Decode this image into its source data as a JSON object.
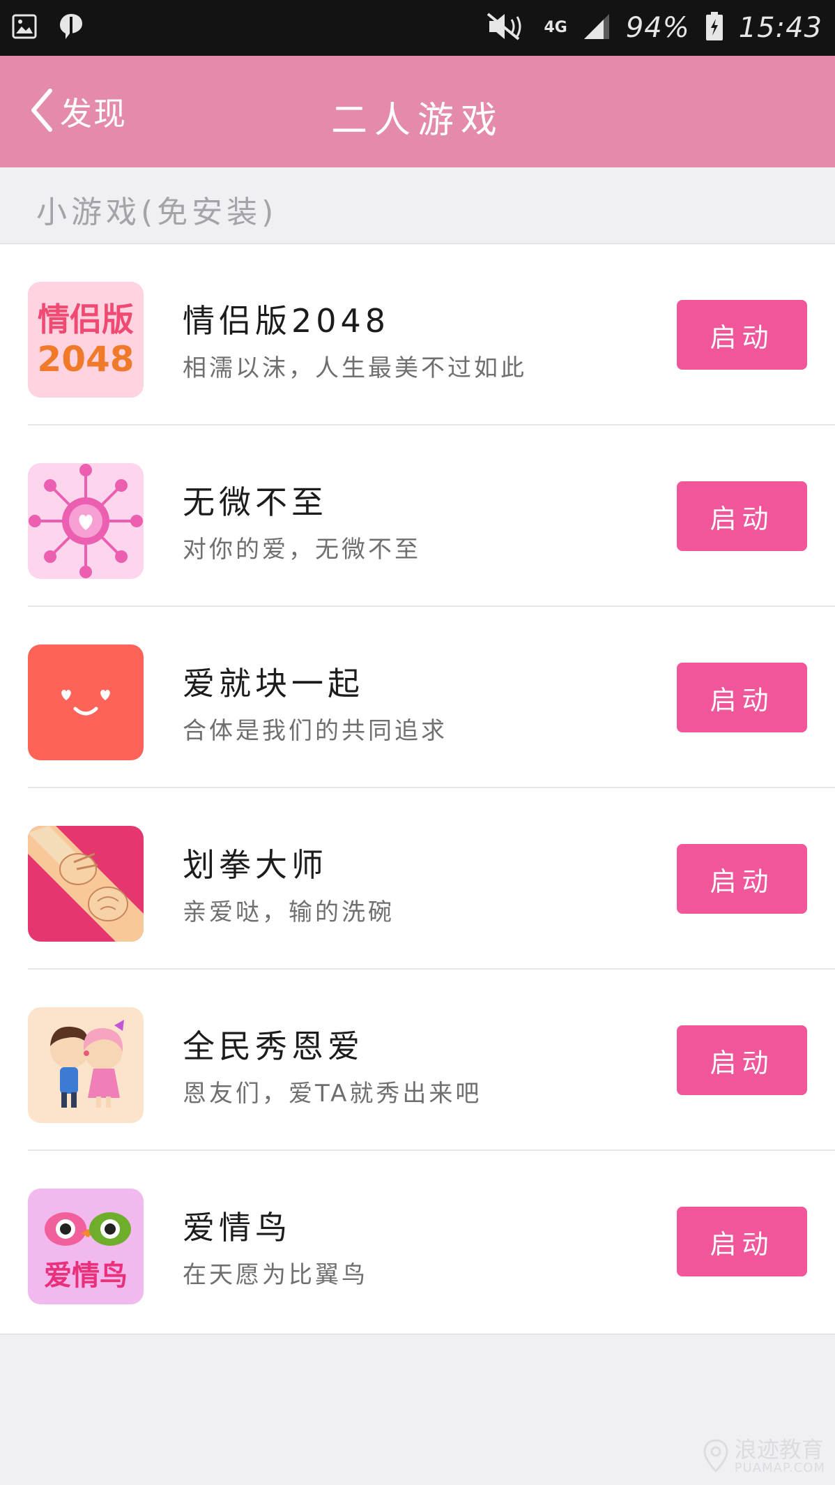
{
  "status_bar": {
    "network": "4G",
    "battery": "94%",
    "time": "15:43",
    "icons": [
      "gallery-icon",
      "app-notification-icon",
      "mute-icon",
      "signal-icon",
      "battery-icon"
    ]
  },
  "header": {
    "back_label": "发现",
    "title": "二人游戏",
    "background": "#e48aab"
  },
  "section": {
    "title": "小游戏(免安装)"
  },
  "games": [
    {
      "name": "情侣版2048",
      "desc": "相濡以沫，人生最美不过如此",
      "button": "启动",
      "icon": "couple-2048-icon",
      "icon_text_top": "情侣版",
      "icon_text_bottom": "2048"
    },
    {
      "name": "无微不至",
      "desc": "对你的爱，无微不至",
      "button": "启动",
      "icon": "heart-network-icon"
    },
    {
      "name": "爱就块一起",
      "desc": "合体是我们的共同追求",
      "button": "启动",
      "icon": "smiley-face-icon"
    },
    {
      "name": "划拳大师",
      "desc": "亲爱哒，输的洗碗",
      "button": "启动",
      "icon": "hand-game-icon"
    },
    {
      "name": "全民秀恩爱",
      "desc": "恩友们，爱TA就秀出来吧",
      "button": "启动",
      "icon": "kissing-couple-icon"
    },
    {
      "name": "爱情鸟",
      "desc": "在天愿为比翼鸟",
      "button": "启动",
      "icon": "love-birds-icon",
      "icon_text": "爱情鸟"
    }
  ],
  "colors": {
    "accent": "#f0569a",
    "list_bg": "#ffffff",
    "page_bg": "#efeff4"
  },
  "watermark": {
    "text": "浪迹教育",
    "sub": "PUAMAP.COM"
  }
}
